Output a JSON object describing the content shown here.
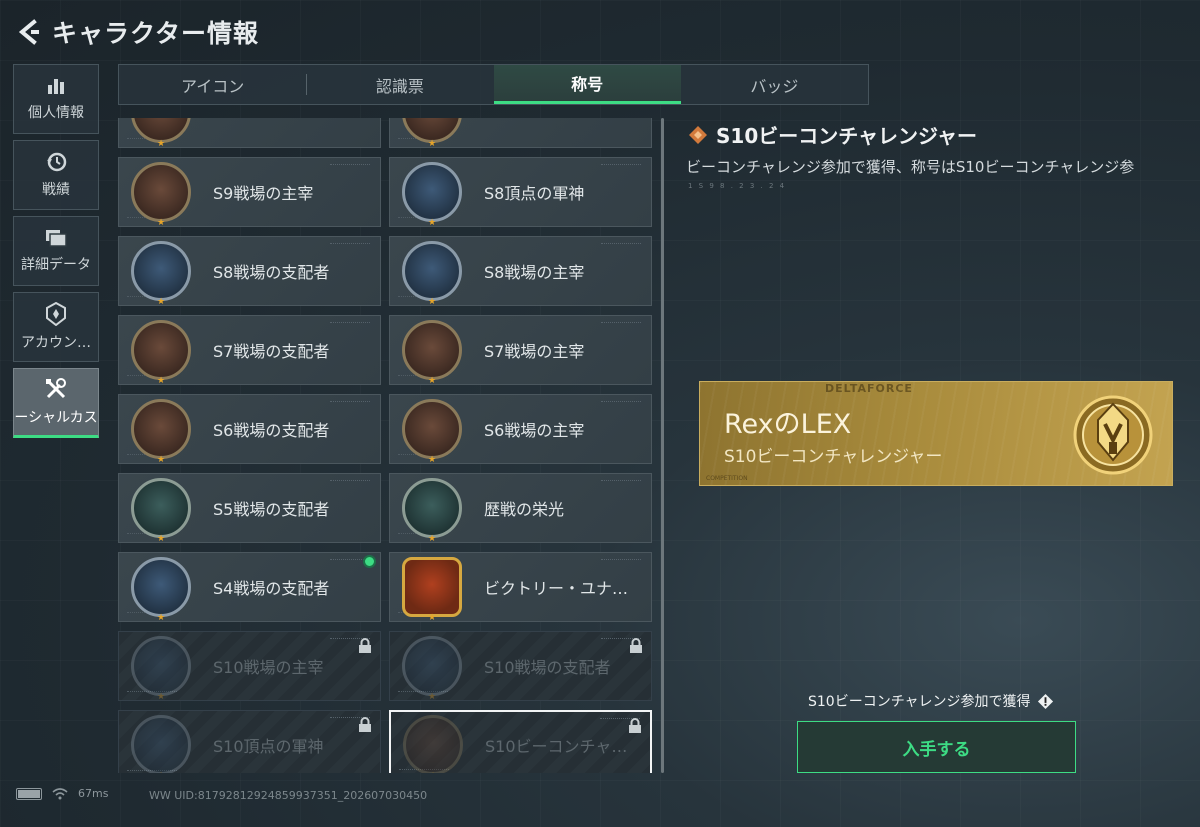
{
  "header": {
    "title": "キャラクター情報"
  },
  "side_nav": [
    {
      "label": "個人情報",
      "icon": "bar-chart-icon",
      "active": false
    },
    {
      "label": "戦績",
      "icon": "clock-icon",
      "active": false
    },
    {
      "label": "詳細データ",
      "icon": "folder-icon",
      "active": false
    },
    {
      "label": "アカウン…",
      "icon": "badge-icon",
      "active": false
    },
    {
      "label": "ーシャルカス",
      "icon": "tools-icon",
      "active": true
    }
  ],
  "tabs": [
    {
      "label": "アイコン",
      "active": false
    },
    {
      "label": "認識票",
      "active": false
    },
    {
      "label": "称号",
      "active": true
    },
    {
      "label": "バッジ",
      "active": false
    }
  ],
  "titles": [
    {
      "label": "",
      "emblem": "partial-emblem",
      "style": "",
      "locked": false
    },
    {
      "label": "",
      "emblem": "partial-emblem",
      "style": "",
      "locked": false
    },
    {
      "label": "S9戦場の主宰",
      "emblem": "mushroom-cloud-emblem",
      "style": "",
      "locked": false
    },
    {
      "label": "S8頂点の軍神",
      "emblem": "striped-orb-emblem",
      "style": "blue",
      "locked": false
    },
    {
      "label": "S8戦場の支配者",
      "emblem": "train-emblem",
      "style": "blue",
      "locked": false
    },
    {
      "label": "S8戦場の主宰",
      "emblem": "skyscraper-emblem",
      "style": "blue",
      "locked": false
    },
    {
      "label": "S7戦場の支配者",
      "emblem": "armored-car-emblem",
      "style": "",
      "locked": false
    },
    {
      "label": "S7戦場の主宰",
      "emblem": "commander-emblem",
      "style": "",
      "locked": false
    },
    {
      "label": "S6戦場の支配者",
      "emblem": "jet-emblem",
      "style": "",
      "locked": false
    },
    {
      "label": "S6戦場の主宰",
      "emblem": "crossed-flags-emblem",
      "style": "",
      "locked": false
    },
    {
      "label": "S5戦場の支配者",
      "emblem": "boat-emblem",
      "style": "teal",
      "locked": false
    },
    {
      "label": "歴戦の栄光",
      "emblem": "trophy-emblem",
      "style": "teal",
      "locked": false
    },
    {
      "label": "S4戦場の支配者",
      "emblem": "missile-emblem",
      "style": "blue",
      "locked": false,
      "new": true
    },
    {
      "label": "ビクトリー・ユナ…",
      "emblem": "medal-emblem",
      "style": "gold",
      "locked": false
    },
    {
      "label": "S10戦場の主宰",
      "emblem": "colosseum-emblem",
      "style": "blue",
      "locked": true
    },
    {
      "label": "S10戦場の支配者",
      "emblem": "plane-emblem",
      "style": "blue",
      "locked": true
    },
    {
      "label": "S10頂点の軍神",
      "emblem": "tower-emblem",
      "style": "blue",
      "locked": true
    },
    {
      "label": "S10ビーコンチャ…",
      "emblem": "beacon-emblem",
      "style": "",
      "locked": true,
      "selected": true
    }
  ],
  "detail": {
    "title": "S10ビーコンチャレンジャー",
    "description": "ビーコンチャレンジ参加で獲得、称号はS10ビーコンチャレンジ参",
    "sub": "1 S 9 8 . 2 3 . 2 4"
  },
  "banner": {
    "brand": "DELTAFORCE",
    "player_name": "RexのLEX",
    "title": "S10ビーコンチャレンジャー",
    "footer": "COMPETITION"
  },
  "unlock": {
    "text": "S10ビーコンチャレンジ参加で獲得",
    "button_label": "入手する"
  },
  "status": {
    "ping": "67ms",
    "uid": "WW UID:817928129248599373​51_202607030450"
  },
  "colors": {
    "accent": "#3ddc84",
    "gold": "#c3a350",
    "panel": "#3a464d"
  }
}
